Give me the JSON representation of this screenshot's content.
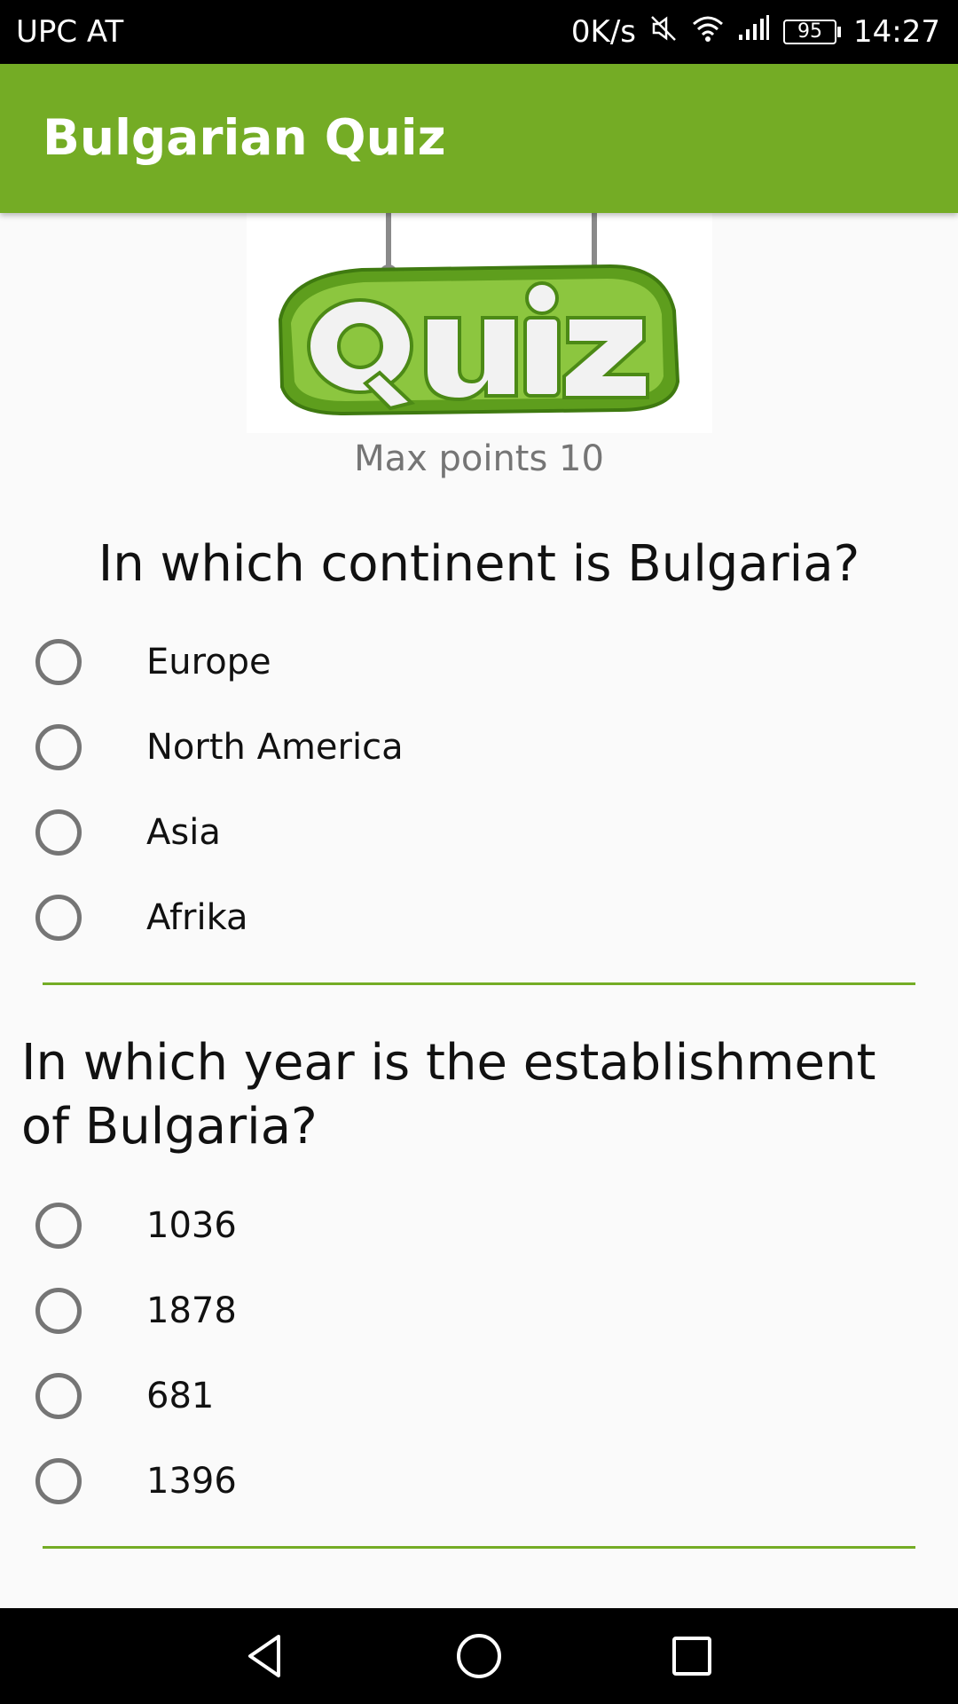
{
  "status_bar": {
    "carrier": "UPC AT",
    "speed": "0K/s",
    "battery": "95",
    "time": "14:27",
    "icons": [
      "mute-icon",
      "wifi-icon",
      "signal-icon",
      "battery-icon"
    ]
  },
  "app_bar": {
    "title": "Bulgarian Quiz",
    "color": "#74ac25"
  },
  "header": {
    "logo_alt": "Quiz",
    "max_points": "Max points 10"
  },
  "questions": [
    {
      "text": "In which continent is Bulgaria?",
      "options": [
        "Europe",
        "North America",
        "Asia",
        "Afrika"
      ]
    },
    {
      "text": "In which year is the establishment of Bulgaria?",
      "options": [
        "1036",
        "1878",
        "681",
        "1396"
      ]
    }
  ],
  "nav_bar": {
    "icons": [
      "back-icon",
      "home-icon",
      "recents-icon"
    ]
  }
}
